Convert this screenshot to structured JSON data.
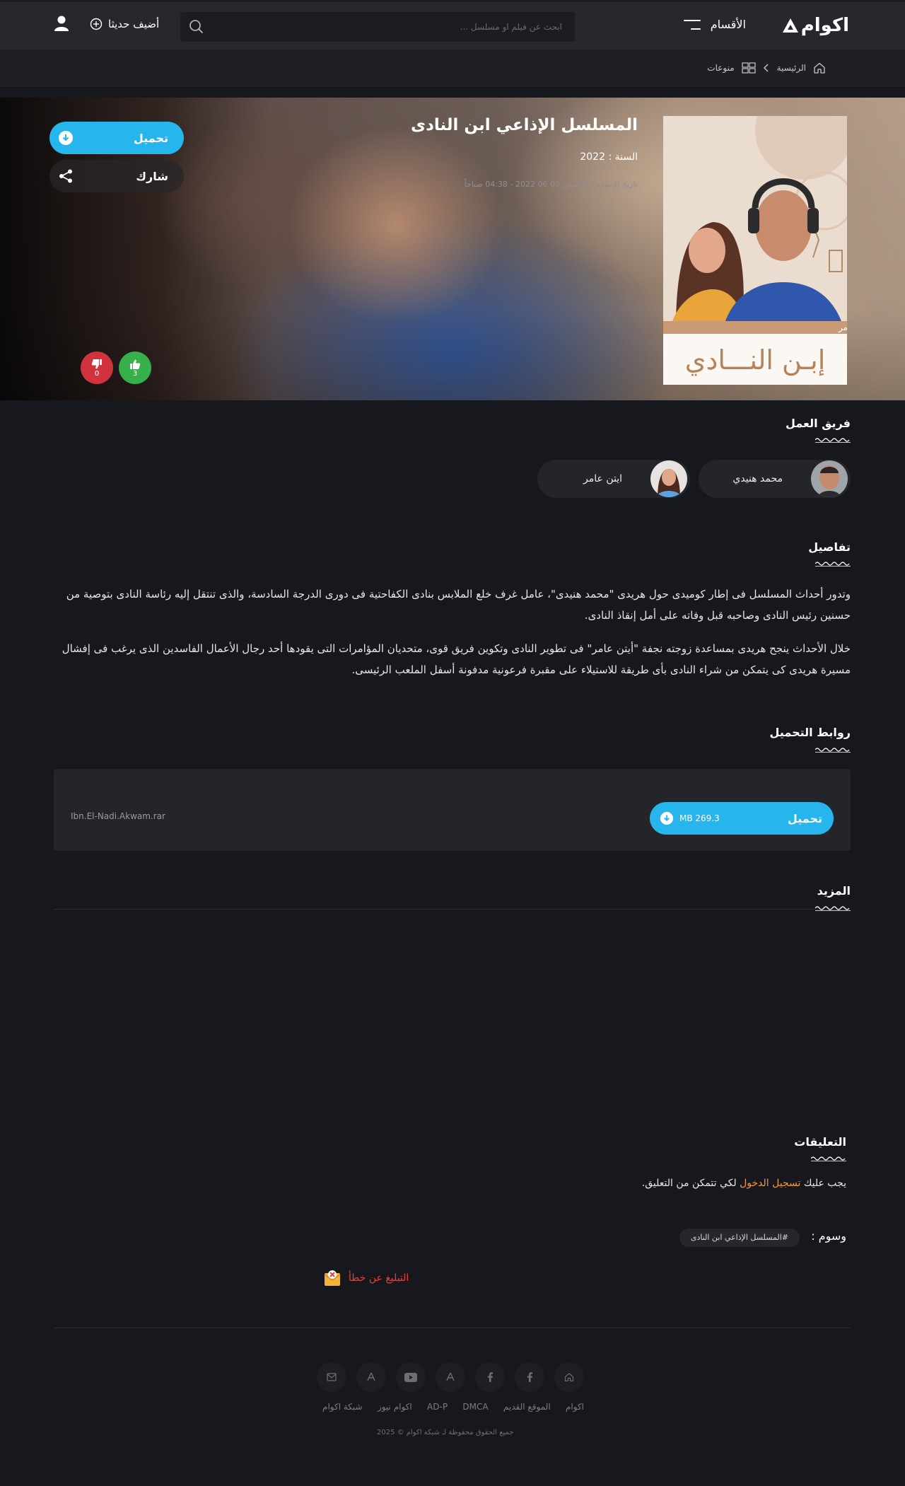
{
  "header": {
    "logo_text": "اكوام",
    "menu_label": "الأقسام",
    "search_placeholder": "ابحث عن فيلم او مسلسل ...",
    "add_recent_label": "أضيف حديثا"
  },
  "breadcrumb": {
    "home": "الرئيسية",
    "category": "منوعات"
  },
  "show": {
    "title": "المسلسل الإذاعي ابن النادى",
    "year_label": "السنة :",
    "year": "2022",
    "added_label": "تاريخ الإضافة :",
    "added_value": "الخميس 09 06 2022 - 04:38 صباحاً",
    "poster": {
      "cast_caption": "محمد هنيدي - أيتن عامر",
      "logo_text": "إبـن النـــادي"
    },
    "download_label": "تحميل",
    "share_label": "شارك",
    "likes": "3",
    "dislikes": "0"
  },
  "sections": {
    "cast": "فريق العمل",
    "details": "تفاصيل",
    "downloads": "روابط التحميل",
    "more": "المزيد",
    "comments": "التعليقات"
  },
  "cast": [
    {
      "name": "محمد هنيدي"
    },
    {
      "name": "ايتن عامر"
    }
  ],
  "details": {
    "p1": "وتدور أحداث المسلسل فى إطار كوميدى حول هريدى \"محمد هنيدى\"، عامل غرف خلع الملابس بنادى الكفاحتية فى دورى الدرجة السادسة، والذى تنتقل إليه رئاسة النادى بتوصية من حسنين رئيس النادى وصاحبه قبل وفاته على أمل إنقاذ النادى.",
    "p2": "خلال الأحداث ينجح هريدى بمساعدة زوجته نجفة \"أيتن عامر\" فى تطوير النادى وتكوين فريق قوى، متحديان المؤامرات التى يقودها أحد رجال الأعمال الفاسدين الذى يرغب فى إفشال مسيرة هريدى كى يتمكن من شراء النادى بأى طريقة للاستيلاء على مقبرة فرعونية مدفونة أسفل الملعب الرئيسى."
  },
  "download": {
    "button_label": "تحميل",
    "size": "MB 269.3",
    "file_name": "Ibn.El-Nadi.Akwam.rar"
  },
  "comments": {
    "prefix": "يجب عليك",
    "login_link": "تسجيل الدخول",
    "suffix": "لكي تتمكن من التعليق."
  },
  "tags": {
    "label": "وسوم :",
    "items": [
      "#المسلسل الإذاعي ابن النادى"
    ]
  },
  "report_label": "التبليغ عن خطأ",
  "footer": {
    "links": [
      "اكوام",
      "الموقع القديم",
      "DMCA",
      "AD-P",
      "اكوام نيوز",
      "شبكة اكوام"
    ],
    "copyright": "جميع الحقوق محفوظة لـ شبكة اكوام © 2025"
  },
  "icons": {
    "home": "home-icon",
    "category": "grid-icon",
    "search": "search-icon",
    "user": "user-icon",
    "plus": "plus-circle-icon",
    "download": "download-icon",
    "share": "share-icon",
    "like": "thumbs-up-icon",
    "dislike": "thumbs-down-icon",
    "report": "alert-mail-icon"
  },
  "colors": {
    "accent": "#27b5ee",
    "like": "#35b04a",
    "dislike": "#d0333d",
    "link": "#f19a3e",
    "report": "#e0453d",
    "background": "#17181d"
  }
}
